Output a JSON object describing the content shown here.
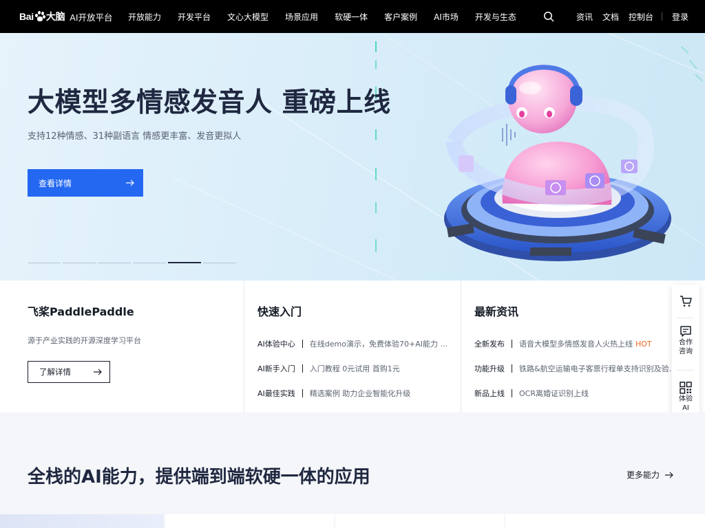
{
  "colors": {
    "primary": "#2468f2",
    "nav_bg": "#000000",
    "hot": "#f26622",
    "title": "#1f2840"
  },
  "header": {
    "logo_text_1": "Bai",
    "logo_text_2": "大脑",
    "logo_icon": "baidu-paw-logo",
    "subtitle": "AI开放平台",
    "nav": [
      "开放能力",
      "开发平台",
      "文心大模型",
      "场景应用",
      "软硬一体",
      "客户案例",
      "AI市场",
      "开发与生态"
    ],
    "search_icon": "search-icon",
    "right_links": {
      "news": "资讯",
      "docs": "文档",
      "console": "控制台",
      "login": "登录"
    }
  },
  "hero": {
    "title": "大模型多情感发音人 重磅上线",
    "subtitle": "支持12种情感、31种副语言 情感更丰富、发音更拟人",
    "button": "查看详情",
    "slide_count": 6,
    "active_slide": 5
  },
  "cards": {
    "paddle": {
      "title": "飞桨PaddlePaddle",
      "desc": "源于产业实践的开源深度学习平台",
      "button": "了解详情"
    },
    "quickstart": {
      "title": "快速入门",
      "items": [
        {
          "key": "AI体验中心",
          "value": "在线demo演示，免费体验70+AI能力 ..."
        },
        {
          "key": "AI新手入门",
          "value": "入门教程 0元试用 首购1元"
        },
        {
          "key": "AI最佳实践",
          "value": "精选案例 助力企业智能化升级"
        }
      ]
    },
    "news": {
      "title": "最新资讯",
      "items": [
        {
          "key": "全新发布",
          "value": "语音大模型多情感发音人火热上线",
          "badge": "HOT"
        },
        {
          "key": "功能升级",
          "value": "铁路&航空运输电子客票行程单支持识别及验...",
          "badge": ""
        },
        {
          "key": "新品上线",
          "value": "OCR离婚证识别上线",
          "badge": ""
        }
      ]
    }
  },
  "sidebar": {
    "cart_icon": "cart-icon",
    "consult_icon": "message-icon",
    "consult_label_1": "合作",
    "consult_label_2": "咨询",
    "qr_icon": "qrcode-icon",
    "qr_label_1": "体验",
    "qr_label_2": "AI"
  },
  "capability": {
    "title": "全栈的AI能力，提供端到端软硬一体的应用",
    "more": "更多能力"
  }
}
